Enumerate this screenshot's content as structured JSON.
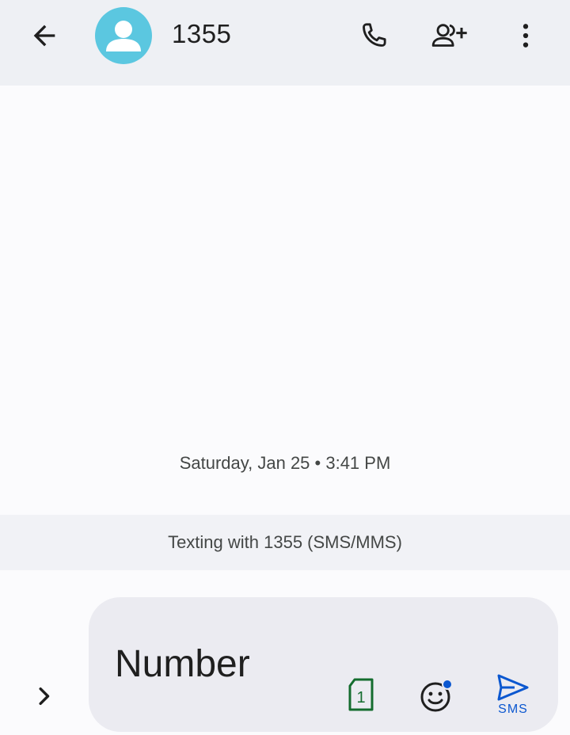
{
  "header": {
    "title": "1355",
    "icons": {
      "back": "arrow-back-icon",
      "avatar": "person-avatar-icon",
      "call": "phone-icon",
      "add_contact": "add-person-icon",
      "more": "more-vert-icon"
    },
    "avatar_color": "#5bc7e0"
  },
  "conversation": {
    "timestamp": "Saturday, Jan 25 • 3:41 PM",
    "texting_info": "Texting with 1355 (SMS/MMS)"
  },
  "composer": {
    "text": "Number",
    "send_label": "SMS",
    "sim_number": "1",
    "icons": {
      "expand": "chevron-right-icon",
      "sim": "sim-card-icon",
      "emoji": "emoji-icon",
      "send": "send-icon"
    },
    "colors": {
      "sim": "#146c2e",
      "send": "#0b57d0",
      "emoji_badge": "#0b57d0"
    }
  }
}
